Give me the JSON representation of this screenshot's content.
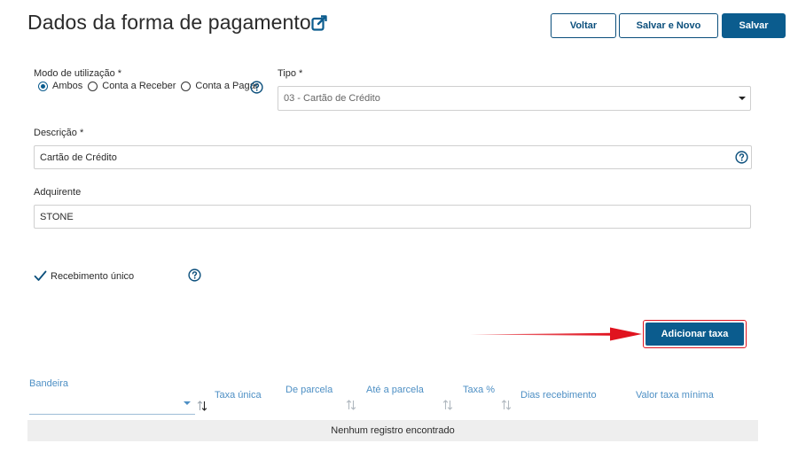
{
  "header": {
    "title": "Dados da forma de pagamento",
    "back_label": "Voltar",
    "save_new_label": "Salvar e Novo",
    "save_label": "Salvar"
  },
  "form": {
    "modo_label": "Modo de utilização *",
    "modo_options": [
      "Ambos",
      "Conta a Receber",
      "Conta a Pagar"
    ],
    "modo_selected": "Ambos",
    "tipo_label": "Tipo *",
    "tipo_value": "03 - Cartão de Crédito",
    "descricao_label": "Descrição *",
    "descricao_value": "Cartão de Crédito",
    "adquirente_label": "Adquirente",
    "adquirente_value": "STONE",
    "recebimento_label": "Recebimento único",
    "recebimento_checked": true
  },
  "actions": {
    "add_fee_label": "Adicionar taxa"
  },
  "table": {
    "columns": [
      "Bandeira",
      "Taxa única",
      "De parcela",
      "Até a parcela",
      "Taxa %",
      "Dias recebimento",
      "Valor taxa mínima"
    ],
    "empty_text": "Nenhum registro encontrado"
  },
  "colors": {
    "primary": "#0b5c8e",
    "highlight": "#e0131f",
    "table_header": "#4d8fc4"
  }
}
